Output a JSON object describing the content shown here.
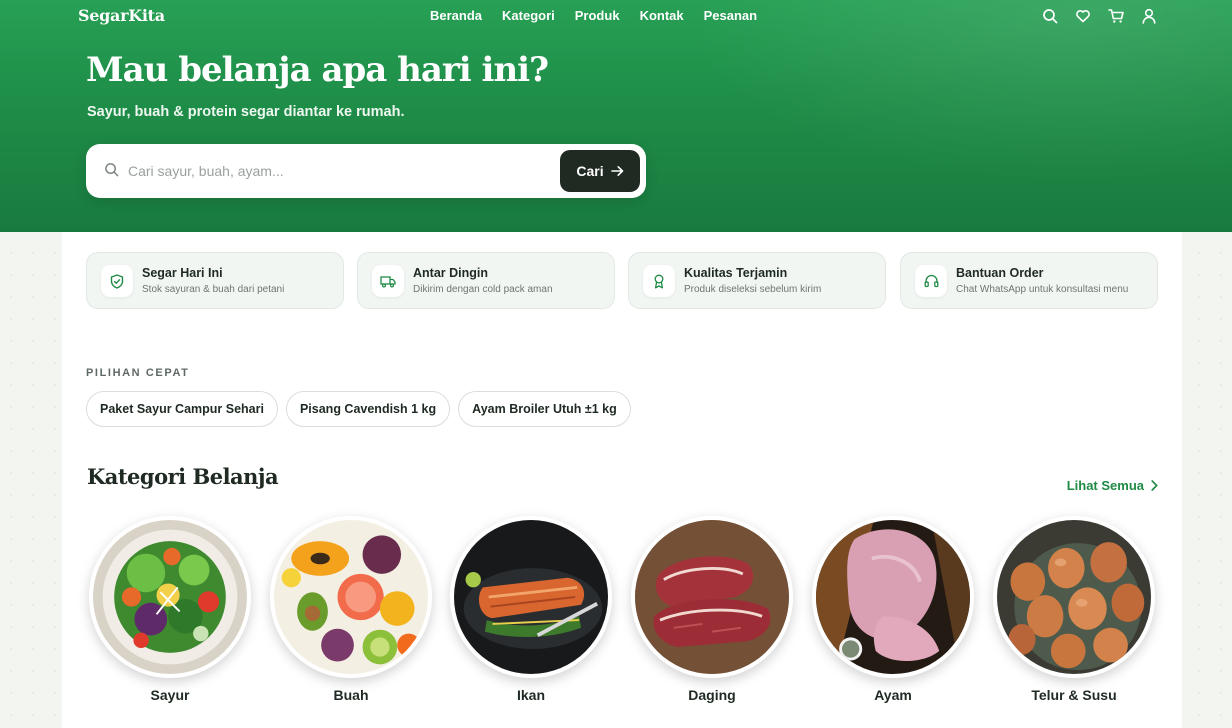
{
  "nav": {
    "logo": "SegarKita",
    "links": [
      "Beranda",
      "Kategori",
      "Produk",
      "Kontak",
      "Pesanan"
    ],
    "icons": [
      "search-icon",
      "heart-icon",
      "cart-icon",
      "user-icon"
    ]
  },
  "hero": {
    "title": "Mau belanja apa hari ini?",
    "subtitle": "Sayur, buah & protein segar diantar ke rumah.",
    "search_placeholder": "Cari sayur, buah, ayam...",
    "search_button": "Cari"
  },
  "features": [
    {
      "title": "Segar Hari Ini",
      "desc": "Stok sayuran & buah dari petani",
      "icon": "shield-check-icon"
    },
    {
      "title": "Antar Dingin",
      "desc": "Dikirim dengan cold pack aman",
      "icon": "truck-icon"
    },
    {
      "title": "Kualitas Terjamin",
      "desc": "Produk diseleksi sebelum kirim",
      "icon": "award-icon"
    },
    {
      "title": "Bantuan Order",
      "desc": "Chat WhatsApp untuk konsultasi menu",
      "icon": "headphones-icon"
    }
  ],
  "quick": {
    "label": "PILIHAN CEPAT",
    "chips": [
      "Paket Sayur Campur Sehari",
      "Pisang Cavendish 1 kg",
      "Ayam Broiler Utuh ±1 kg"
    ]
  },
  "categories": {
    "title": "Kategori Belanja",
    "see_all": "Lihat Semua",
    "items": [
      "Sayur",
      "Buah",
      "Ikan",
      "Daging",
      "Ayam",
      "Telur & Susu"
    ]
  },
  "colors": {
    "brand_green": "#1f8f49",
    "dark_button": "#1f2a22",
    "link_green": "#1f8a45"
  }
}
